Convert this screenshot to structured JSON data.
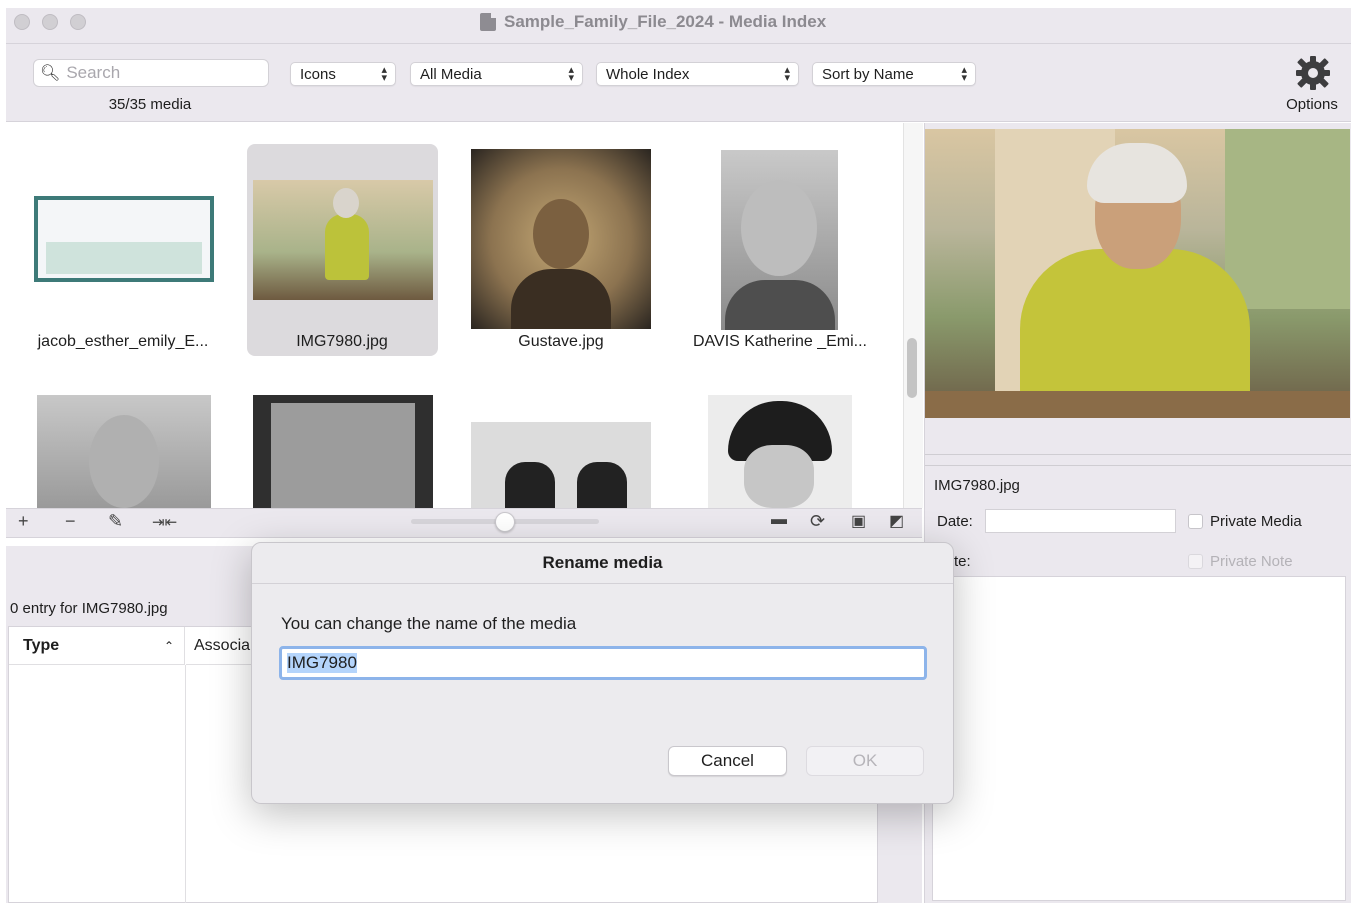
{
  "window": {
    "title": "Sample_Family_File_2024 - Media Index"
  },
  "toolbar": {
    "search_placeholder": "Search",
    "media_count": "35/35 media",
    "view_mode": "Icons",
    "media_filter": "All Media",
    "scope": "Whole Index",
    "sort": "Sort by Name",
    "options_label": "Options"
  },
  "grid": {
    "items": [
      {
        "label": "jacob_esther_emily_E..."
      },
      {
        "label": "IMG7980.jpg",
        "selected": true
      },
      {
        "label": "Gustave.jpg"
      },
      {
        "label": "DAVIS Katherine _Emi..."
      }
    ],
    "zoom_level": 0.5
  },
  "lower": {
    "entries_text": "0 entry for IMG7980.jpg",
    "col_type": "Type",
    "col_assoc": "Associa"
  },
  "details": {
    "filename": "IMG7980.jpg",
    "date_label": "Date:",
    "private_media_label": "Private Media",
    "note_label": "te:",
    "private_note_label": "Private Note"
  },
  "dialog": {
    "title": "Rename media",
    "message": "You can change the name of the media",
    "input_value": "IMG7980",
    "cancel_label": "Cancel",
    "ok_label": "OK"
  }
}
